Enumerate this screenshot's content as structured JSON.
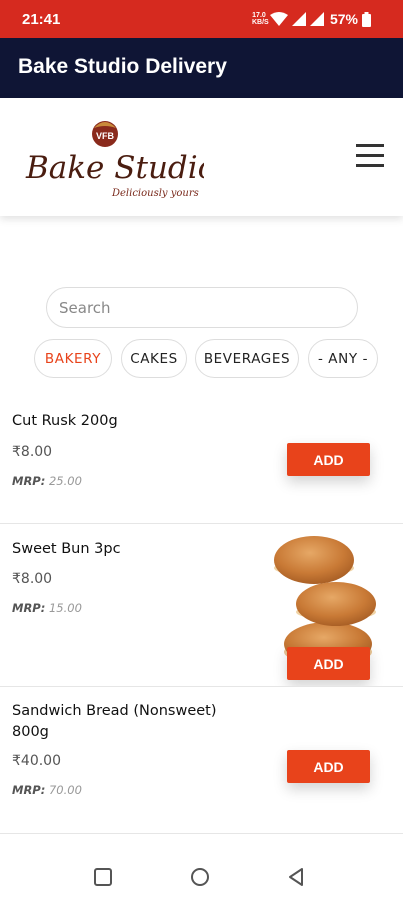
{
  "status_bar": {
    "time": "21:41",
    "net_speed_value": "17.0",
    "net_speed_unit": "KB/S",
    "battery": "57%"
  },
  "app_bar": {
    "title": "Bake Studio Delivery"
  },
  "header": {
    "logo_text": "Bake Studio",
    "logo_badge": "VFB",
    "logo_tagline": "Deliciously yours"
  },
  "search": {
    "placeholder": "Search",
    "value": ""
  },
  "categories": [
    {
      "label": "BAKERY",
      "active": true
    },
    {
      "label": "CAKES",
      "active": false
    },
    {
      "label": "BEVERAGES",
      "active": false
    },
    {
      "label": "- ANY -",
      "active": false
    }
  ],
  "products": [
    {
      "name": "Cut Rusk 200g",
      "price": "₹8.00",
      "mrp_label": "MRP:",
      "mrp_value": "25.00",
      "add_label": "ADD"
    },
    {
      "name": "Sweet Bun 3pc",
      "price": "₹8.00",
      "mrp_label": "MRP:",
      "mrp_value": "15.00",
      "add_label": "ADD"
    },
    {
      "name": "Sandwich Bread (Nonsweet) 800g",
      "price": "₹40.00",
      "mrp_label": "MRP:",
      "mrp_value": "70.00",
      "add_label": "ADD"
    }
  ],
  "colors": {
    "status_bar": "#d62a1f",
    "app_bar": "#0f1535",
    "accent": "#e8431b"
  },
  "icons": {
    "menu": "hamburger-menu-icon",
    "nav_recent": "square-icon",
    "nav_home": "circle-icon",
    "nav_back": "triangle-back-icon"
  }
}
